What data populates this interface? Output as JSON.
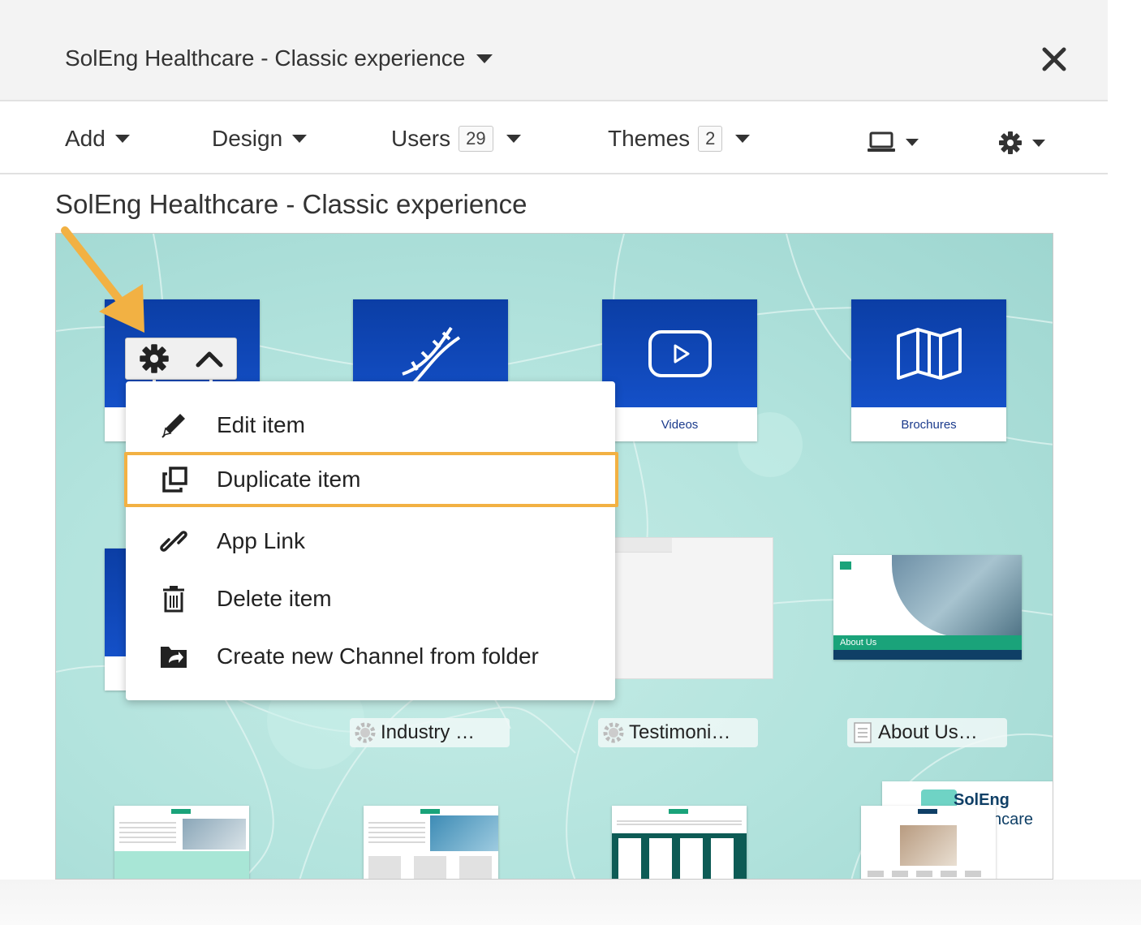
{
  "header": {
    "title": "SolEng Healthcare - Classic experience",
    "close_icon": "close-icon"
  },
  "toolbar": {
    "add_label": "Add",
    "design_label": "Design",
    "users_label": "Users",
    "users_count": "29",
    "themes_label": "Themes",
    "themes_count": "2",
    "device_icon": "laptop-icon",
    "settings_icon": "gear-icon"
  },
  "page": {
    "title": "SolEng Healthcare - Classic experience"
  },
  "tiles": [
    {
      "label": "",
      "icon": "calendar-icon"
    },
    {
      "label": "",
      "icon": "dna-icon"
    },
    {
      "label": "Videos",
      "icon": "play-icon"
    },
    {
      "label": "Brochures",
      "icon": "map-icon"
    }
  ],
  "chips": [
    {
      "label": "Industry …",
      "icon": "gear-icon"
    },
    {
      "label": "Testimoni…",
      "icon": "gear-icon"
    },
    {
      "label": "About Us…",
      "icon": "document-icon"
    }
  ],
  "thumbnails": {
    "about_us_banner": "About Us",
    "logo_text_1": "SolEng",
    "logo_text_2": "ncare"
  },
  "context_menu": {
    "items": [
      {
        "label": "Edit item",
        "icon": "pencil-icon"
      },
      {
        "label": "Duplicate item",
        "icon": "duplicate-icon",
        "highlighted": true
      },
      {
        "label": "App Link",
        "icon": "link-icon"
      },
      {
        "label": "Delete item",
        "icon": "trash-icon"
      },
      {
        "label": "Create new Channel from folder",
        "icon": "folder-share-icon"
      }
    ]
  },
  "colors": {
    "tile_blue": "#0b3ea5",
    "highlight_orange": "#f2b143",
    "canvas_teal": "#b2e3dd",
    "accent_green": "#1aa37a"
  }
}
